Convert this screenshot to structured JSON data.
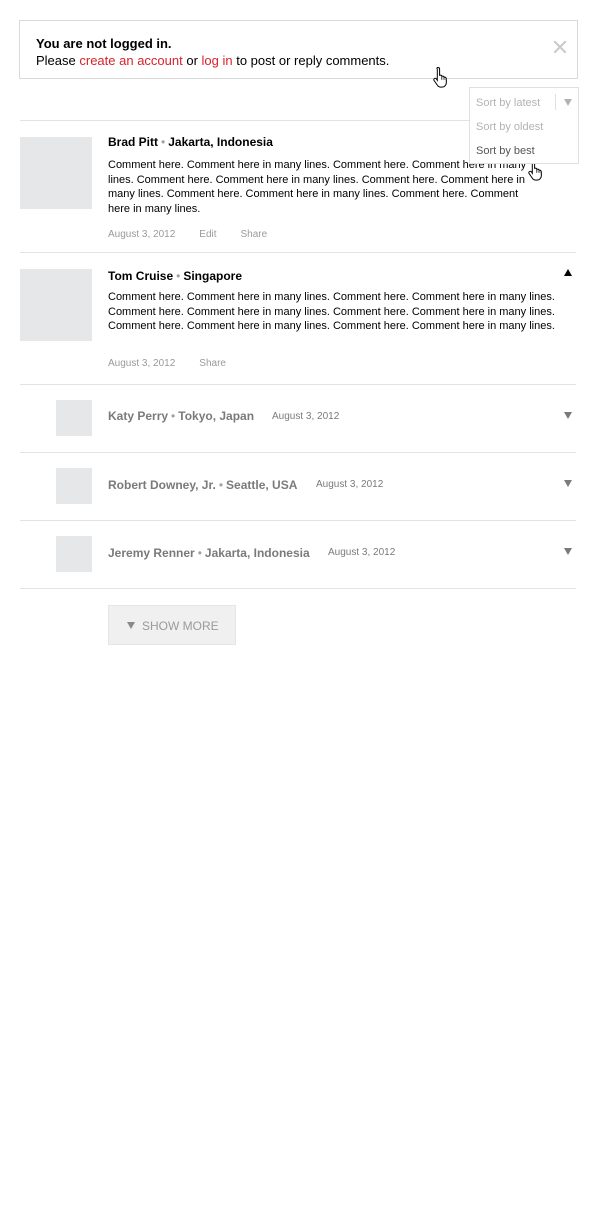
{
  "notice": {
    "title": "You are not logged in.",
    "prefix": "Please ",
    "create_account": "create an account",
    "or": " or ",
    "log_in": "log in",
    "suffix": " to post or reply comments."
  },
  "sort": {
    "options": [
      "Sort by latest",
      "Sort by oldest",
      "Sort by best"
    ],
    "hovered": "Sort by best"
  },
  "comments": [
    {
      "name": "Brad Pitt",
      "location": "Jakarta, Indonesia",
      "body": "Comment here. Comment here in many lines. Comment here. Comment here in many lines. Comment here. Comment here in many lines. Comment here. Comment here in many lines. Comment here. Comment here in many lines. Comment here. Comment here in many lines.",
      "date": "August 3, 2012",
      "actions": [
        "Edit",
        "Share"
      ]
    },
    {
      "name": "Tom Cruise",
      "location": "Singapore",
      "body": "Comment here. Comment here in many lines. Comment here. Comment here in many lines. Comment here. Comment here in many lines. Comment here. Comment here in many lines. Comment here. Comment here in many lines. Comment here. Comment here in many lines.",
      "date": "August 3, 2012",
      "actions": [
        "Share"
      ]
    }
  ],
  "replies": [
    {
      "name": "Katy Perry",
      "location": "Tokyo, Japan",
      "date": "August 3, 2012"
    },
    {
      "name": "Robert Downey, Jr.",
      "location": "Seattle, USA",
      "date": "August 3, 2012"
    },
    {
      "name": "Jeremy Renner",
      "location": "Jakarta, Indonesia",
      "date": "August 3, 2012"
    }
  ],
  "show_more": {
    "label": "SHOW MORE"
  },
  "dot": "•"
}
